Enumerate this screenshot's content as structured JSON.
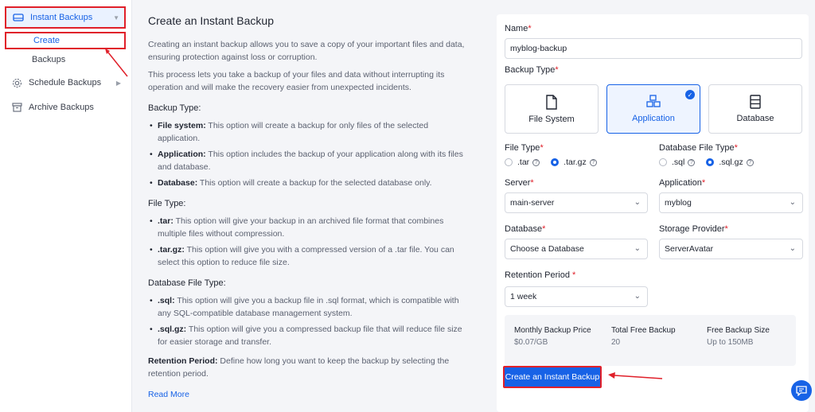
{
  "sidebar": {
    "instant_backups": "Instant Backups",
    "create": "Create",
    "backups": "Backups",
    "schedule_backups": "Schedule Backups",
    "archive_backups": "Archive Backups"
  },
  "info": {
    "title": "Create an Instant Backup",
    "p1": "Creating an instant backup allows you to save a copy of your important files and data, ensuring protection against loss or corruption.",
    "p2": "This process lets you take a backup of your files and data without interrupting its operation and will make the recovery easier from unexpected incidents.",
    "backup_type_heading": "Backup Type:",
    "bt_fs_label": "File system:",
    "bt_fs_text": " This option will create a backup for only files of the selected application.",
    "bt_app_label": "Application:",
    "bt_app_text": " This option includes the backup of your application along with its files and database.",
    "bt_db_label": "Database:",
    "bt_db_text": " This option will create a backup for the selected database only.",
    "file_type_heading": "File Type:",
    "ft_tar_label": ".tar:",
    "ft_tar_text": " This option will give your backup in an archived file format that combines multiple files without compression.",
    "ft_targz_label": ".tar.gz:",
    "ft_targz_text": " This option will give you with a compressed version of a .tar file. You can select this option to reduce file size.",
    "db_file_type_heading": "Database File Type:",
    "dft_sql_label": ".sql:",
    "dft_sql_text": " This option will give you a backup file in .sql format, which is compatible with any SQL-compatible database management system.",
    "dft_sqlgz_label": ".sql.gz:",
    "dft_sqlgz_text": " This option will give you a compressed backup file that will reduce file size for easier storage and transfer.",
    "rp_label": "Retention Period:",
    "rp_text": " Define how long you want to keep the backup by selecting the retention period.",
    "read_more": "Read More"
  },
  "form": {
    "name_label": "Name",
    "name_value": "myblog-backup",
    "backup_type_label": "Backup Type",
    "types": [
      "File System",
      "Application",
      "Database"
    ],
    "file_type_label": "File Type",
    "file_types": [
      ".tar",
      ".tar.gz"
    ],
    "db_file_type_label": "Database File Type",
    "db_file_types": [
      ".sql",
      ".sql.gz"
    ],
    "server_label": "Server",
    "server_value": "main-server",
    "application_label": "Application",
    "application_value": "myblog",
    "database_label": "Database",
    "database_value": "Choose a Database",
    "storage_label": "Storage Provider",
    "storage_value": "ServerAvatar",
    "retention_label": "Retention Period",
    "retention_value": "1 week",
    "required_mark": "*",
    "help_mark": "?",
    "check_mark": "✓",
    "price": {
      "monthly_label": "Monthly Backup Price",
      "monthly_value": "$0.07/GB",
      "free_label": "Total Free Backup",
      "free_value": "20",
      "size_label": "Free Backup Size",
      "size_value": "Up to 150MB"
    },
    "submit": "Create an Instant Backup"
  },
  "colors": {
    "accent": "#1762e6",
    "annotation": "#e0202a"
  }
}
